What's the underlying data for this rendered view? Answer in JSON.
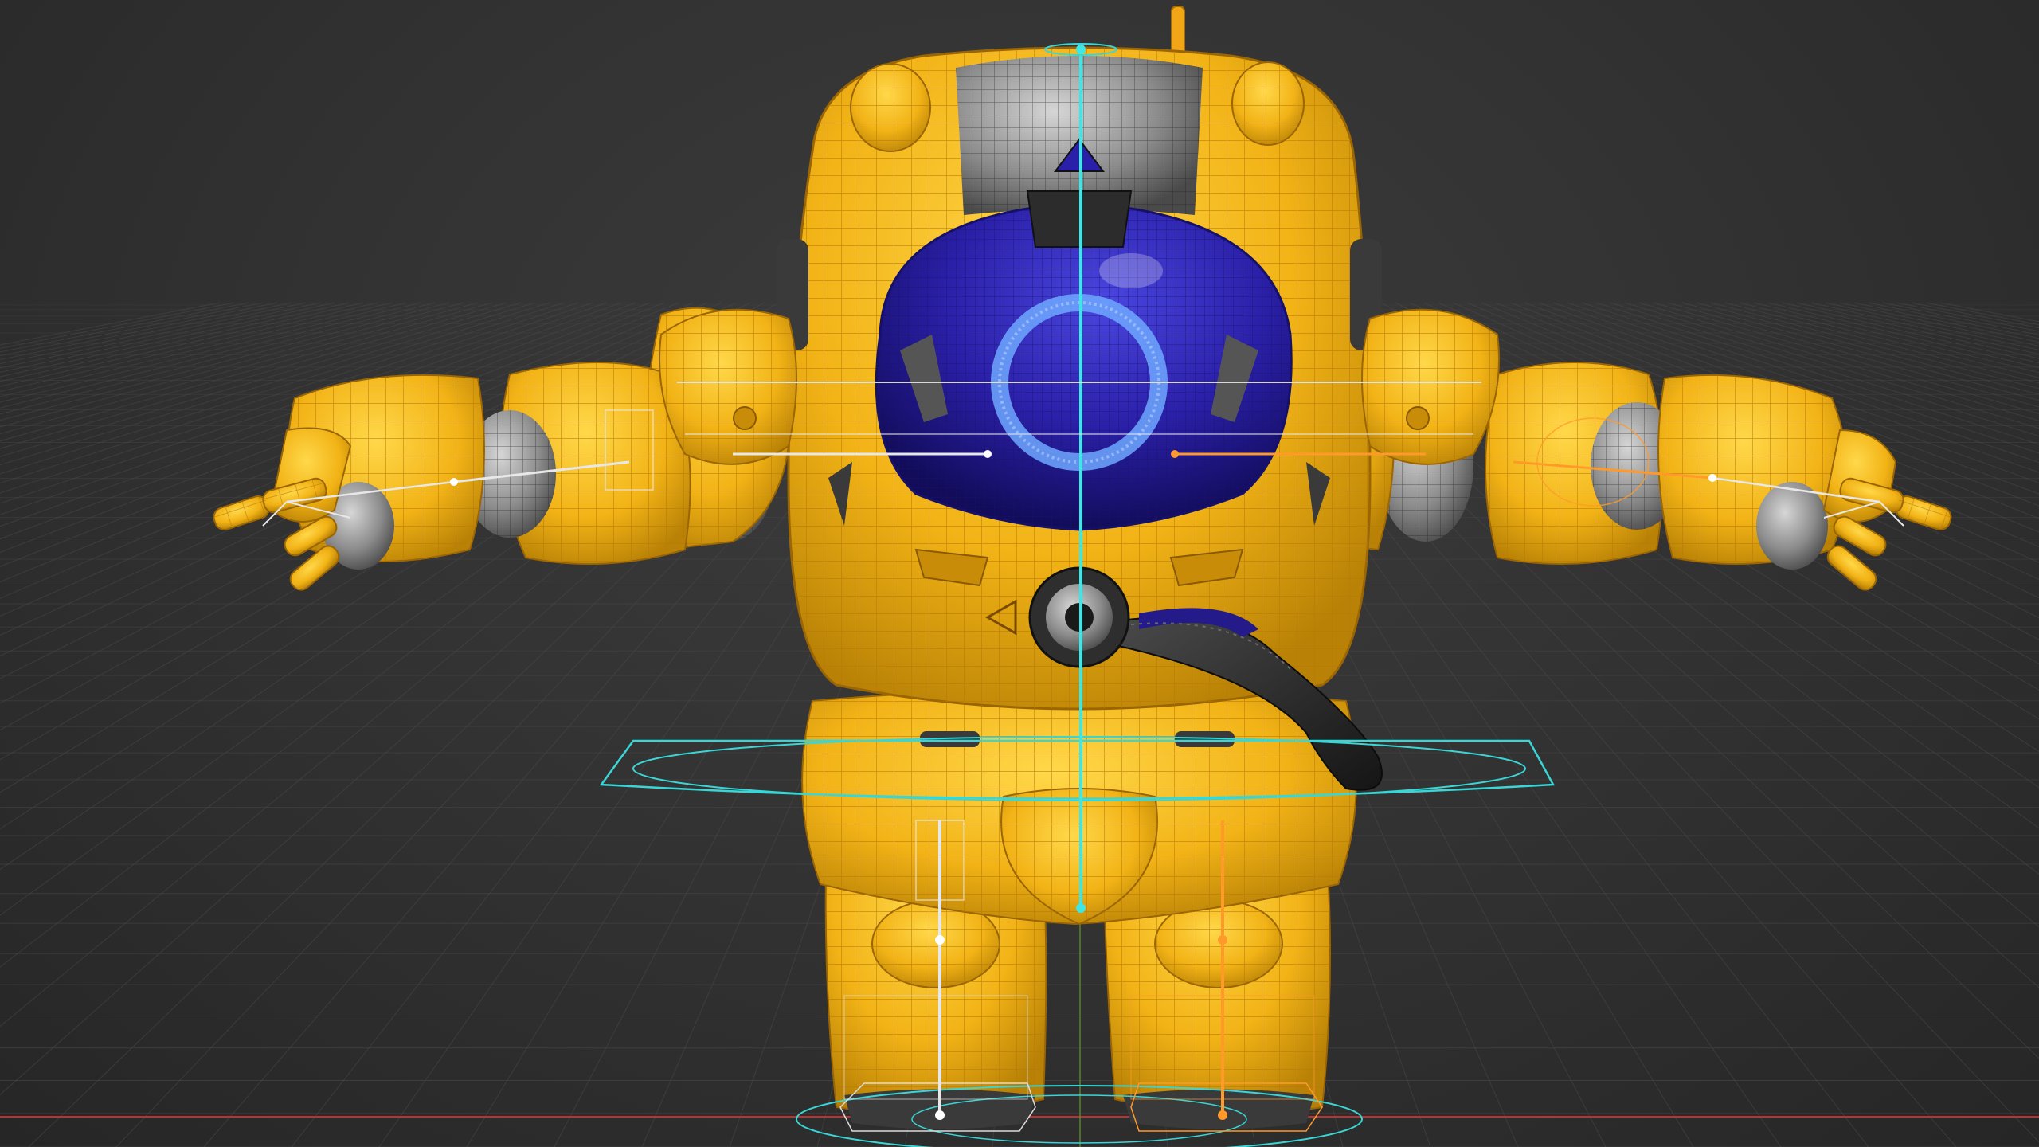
{
  "viewport": {
    "background_color": "#303030",
    "grid_color": "#4a4a4a",
    "x_axis_color": "#c0302f",
    "y_axis_color": "#5a9a2a"
  },
  "model": {
    "body_color": "#f2b316",
    "wire_color": "#b8780a",
    "visor_color": "#2a1fa8",
    "visor_ring_color": "#6fa8ff",
    "metal_color": "#8c8c8c",
    "dark_metal_color": "#3a3a3a",
    "hose_color": "#262626",
    "hose_accent_color": "#241a8a"
  },
  "rig": {
    "main_bone_color": "#3ee6e6",
    "left_leg_color": "#dcdcdc",
    "right_leg_color": "#ff9a2a",
    "arm_bone_color": "#e8e8e8",
    "controller_color": "#3ad6d6"
  },
  "icons": {
    "visor": "visor-ring-icon",
    "arrow_up": "triangle-up-icon",
    "arrow_left": "triangle-left-icon"
  }
}
